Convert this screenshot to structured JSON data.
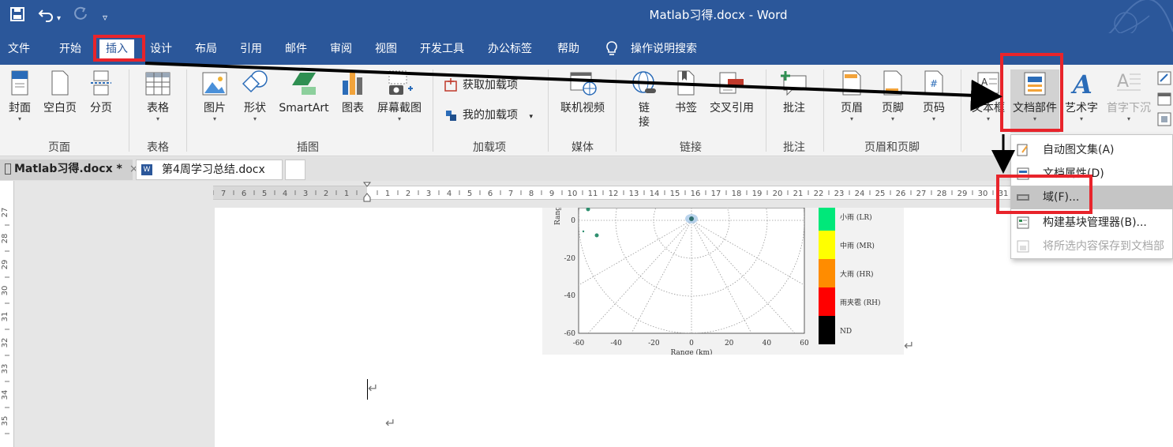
{
  "window": {
    "title": "Matlab习得.docx - Word"
  },
  "quick_access": {
    "save": "save-icon",
    "undo": "undo-icon",
    "redo": "redo-icon",
    "customize": "customize-icon"
  },
  "menu": {
    "tabs": [
      "文件",
      "开始",
      "插入",
      "设计",
      "布局",
      "引用",
      "邮件",
      "审阅",
      "视图",
      "开发工具",
      "办公标签",
      "帮助"
    ],
    "active_tab": "插入",
    "tell_me": "操作说明搜索"
  },
  "ribbon": {
    "page_group": {
      "label": "页面",
      "cover": "封面",
      "blank": "空白页",
      "break": "分页"
    },
    "table_group": {
      "label": "表格",
      "table": "表格"
    },
    "illustrations_group": {
      "label": "插图",
      "pictures": "图片",
      "shapes": "形状",
      "smartart": "SmartArt",
      "chart": "图表",
      "screenshot": "屏幕截图"
    },
    "addins_group": {
      "label": "加载项",
      "get": "获取加载项",
      "my": "我的加载项"
    },
    "media_group": {
      "label": "媒体",
      "video": "联机视频"
    },
    "links_group": {
      "label": "链接",
      "link_1": "链",
      "link_2": "接",
      "bookmark": "书签",
      "cross_ref": "交叉引用"
    },
    "comments_group": {
      "label": "批注",
      "comment": "批注"
    },
    "header_footer_group": {
      "label": "页眉和页脚",
      "header": "页眉",
      "footer": "页脚",
      "page_number": "页码"
    },
    "text_group": {
      "textbox": "文本框",
      "quick_parts": "文档部件",
      "wordart": "艺术字",
      "drop_cap": "首字下沉"
    }
  },
  "doc_tabs": [
    {
      "label": "Matlab习得.docx *",
      "close": "×"
    },
    {
      "label": "第4周学习总结.docx"
    }
  ],
  "ruler": {
    "horizontal_neg": [
      "7",
      "6",
      "5",
      "4",
      "3",
      "2",
      "1"
    ],
    "horizontal_pos": [
      "1",
      "2",
      "3",
      "4",
      "5",
      "6",
      "7",
      "8",
      "9",
      "10",
      "11",
      "12",
      "13",
      "14",
      "15",
      "16",
      "17",
      "18",
      "19",
      "20",
      "21",
      "22",
      "23",
      "24",
      "25",
      "26",
      "27",
      "28",
      "29",
      "30",
      "31"
    ],
    "vertical": [
      "27",
      "28",
      "29",
      "30",
      "31",
      "32",
      "33",
      "34",
      "35"
    ]
  },
  "chart": {
    "y_ticks": [
      "0",
      "-20",
      "-40",
      "-60"
    ],
    "x_ticks": [
      "-60",
      "-40",
      "-20",
      "0",
      "20",
      "40",
      "60"
    ],
    "ylabel": "Range (k",
    "xlabel": "Range (km)",
    "legend": [
      {
        "label": "小雨 (LR)",
        "color": "#00e87a"
      },
      {
        "label": "中雨 (MR)",
        "color": "#ffff00"
      },
      {
        "label": "大雨 (HR)",
        "color": "#ff8c00"
      },
      {
        "label": "雨夹雹 (RH)",
        "color": "#ff0000"
      },
      {
        "label": "ND",
        "color": "#000000"
      }
    ]
  },
  "dropdown": {
    "items": [
      {
        "label": "自动图文集(A)",
        "enabled": true
      },
      {
        "label": "文档属性(D)",
        "enabled": true
      },
      {
        "label": "域(F)...",
        "enabled": true,
        "highlighted": true
      },
      {
        "label": "构建基块管理器(B)...",
        "enabled": true
      },
      {
        "label": "将所选内容保存到文档部",
        "enabled": false
      }
    ]
  },
  "paragraph_mark": "↵",
  "colors": {
    "brand": "#2b579a",
    "annotation": "#e8242b",
    "ribbon_bg": "#f3f3f3"
  }
}
